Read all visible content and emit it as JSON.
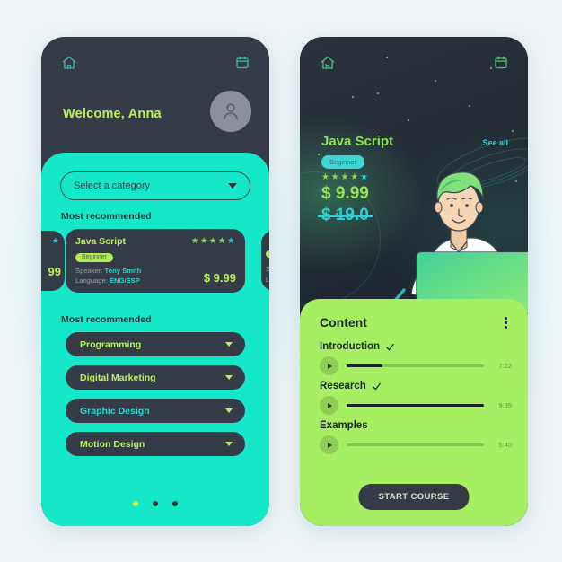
{
  "screen_home": {
    "nav": {
      "home_icon": "home-icon",
      "calendar_icon": "calendar-icon"
    },
    "greeting": "Welcome, Anna",
    "avatar_icon": "user-avatar-icon",
    "category_select": {
      "placeholder": "Select a category",
      "value": ""
    },
    "section_title_1": "Most recommended",
    "section_title_2": "Most recommended",
    "featured_card": {
      "title": "Java Script",
      "badge": "Beginner",
      "stars_filled": 4,
      "stars_accent": 1,
      "speaker_label": "Speaker:",
      "speaker": "Tony Smith",
      "language_label": "Language:",
      "language": "ENG/ESP",
      "price": "$ 9.99"
    },
    "card_prev_fragment": {
      "price": "99",
      "star": "★"
    },
    "card_next_fragment": {
      "speaker_letter": "S",
      "language_letter": "L"
    },
    "categories": [
      {
        "label": "Programming",
        "accent": "green"
      },
      {
        "label": "Digital Marketing",
        "accent": "green"
      },
      {
        "label": "Graphic Design",
        "accent": "cyan"
      },
      {
        "label": "Motion Design",
        "accent": "green"
      }
    ],
    "pagination": {
      "total": 3,
      "active_index": 0
    }
  },
  "screen_course": {
    "nav": {
      "home_icon": "home-icon",
      "calendar_icon": "calendar-icon"
    },
    "title": "Java Script",
    "see_all": "See all",
    "badge": "Beginner",
    "stars_filled": 4,
    "stars_accent": 1,
    "price": "$ 9.99",
    "old_price": "$ 19.0",
    "illustration": "student-at-laptop-illustration",
    "content": {
      "heading": "Content",
      "menu_icon": "kebab-menu-icon",
      "lessons": [
        {
          "name": "Introduction",
          "completed": true,
          "progress": 26,
          "duration": "7:22"
        },
        {
          "name": "Research",
          "completed": true,
          "progress": 100,
          "duration": "9:35"
        },
        {
          "name": "Examples",
          "completed": false,
          "progress": 0,
          "duration": "5:40"
        }
      ],
      "start_button": "START COURSE"
    }
  },
  "colors": {
    "page_bg": "#eef4f6",
    "dark": "#353b47",
    "dark_hero": "#262e35",
    "turquoise": "#14e8c8",
    "lime": "#a6ef63",
    "green_text": "#b9f25c",
    "cyan_text": "#2fd5d0"
  }
}
